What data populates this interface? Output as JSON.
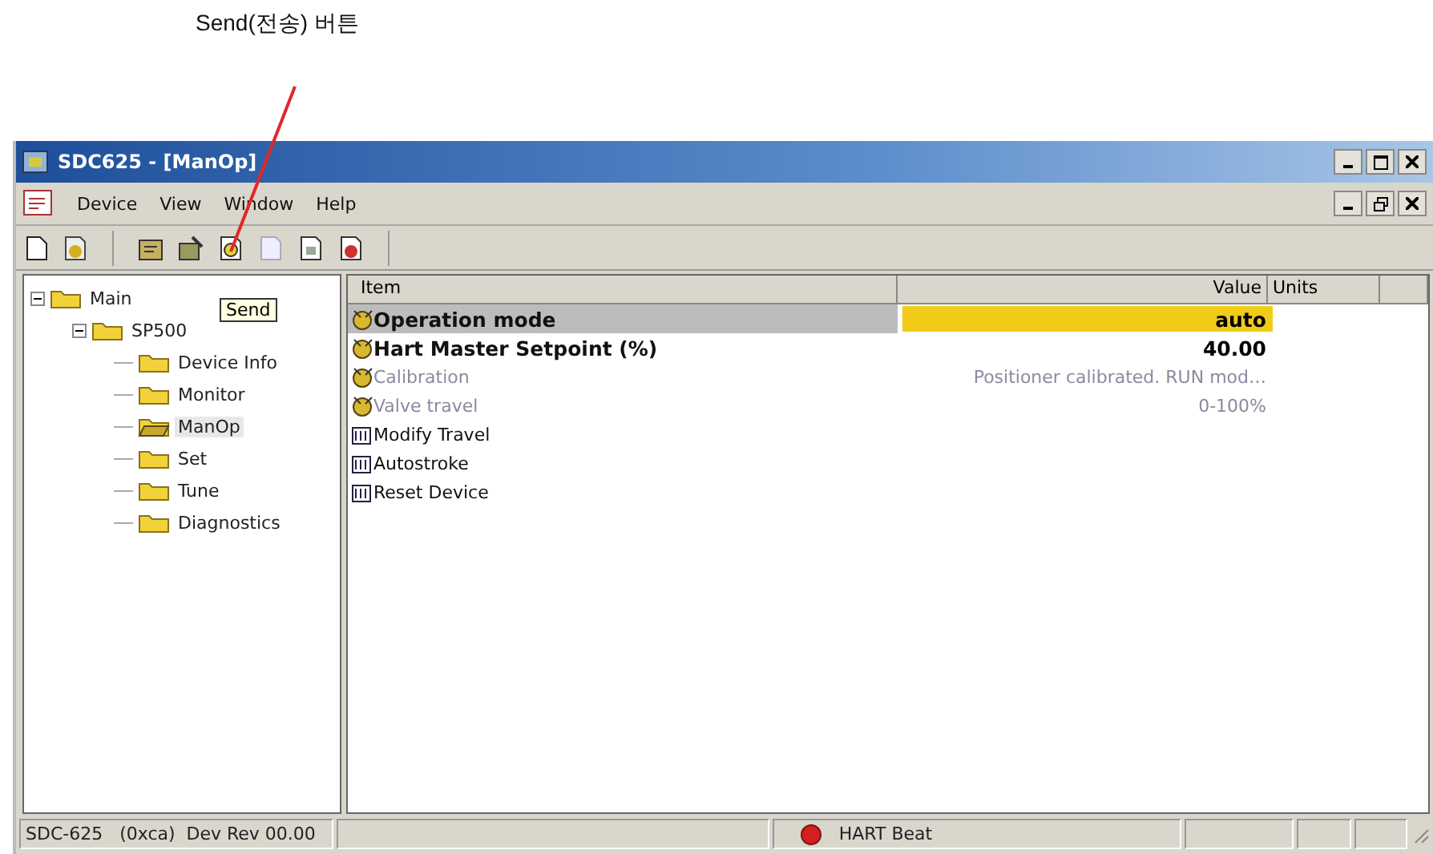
{
  "annotation": {
    "label": "Send(전송) 버튼"
  },
  "window": {
    "title": "SDC625 - [ManOp]"
  },
  "menu": [
    "Device",
    "View",
    "Window",
    "Help"
  ],
  "tooltip": "Send",
  "tree": [
    {
      "label": "Main",
      "expanded": true,
      "selected": false,
      "children": [
        {
          "label": "SP500",
          "expanded": true,
          "selected": false,
          "children": [
            {
              "label": "Device Info",
              "selected": false
            },
            {
              "label": "Monitor",
              "selected": false
            },
            {
              "label": "ManOp",
              "selected": true
            },
            {
              "label": "Set",
              "selected": false
            },
            {
              "label": "Tune",
              "selected": false
            },
            {
              "label": "Diagnostics",
              "selected": false
            }
          ]
        }
      ]
    }
  ],
  "table": {
    "columns": [
      "Item",
      "Value",
      "Units"
    ],
    "rows": [
      {
        "kind": "variable",
        "item": "Operation mode",
        "value": "auto",
        "bold": true,
        "disabled": false,
        "selected": true
      },
      {
        "kind": "variable",
        "item": "Hart Master Setpoint (%)",
        "value": "40.00",
        "bold": true,
        "disabled": false,
        "selected": false
      },
      {
        "kind": "variable",
        "item": "Calibration",
        "value": "Positioner calibrated. RUN mod…",
        "bold": false,
        "disabled": true,
        "selected": false
      },
      {
        "kind": "variable",
        "item": "Valve travel",
        "value": "0-100%",
        "bold": false,
        "disabled": true,
        "selected": false
      },
      {
        "kind": "method",
        "item": "Modify Travel",
        "bold": false,
        "disabled": false,
        "selected": false
      },
      {
        "kind": "method",
        "item": "Autostroke",
        "bold": false,
        "disabled": false,
        "selected": false
      },
      {
        "kind": "method",
        "item": "Reset Device",
        "bold": false,
        "disabled": false,
        "selected": false
      }
    ]
  },
  "status_bar": {
    "device": "SDC-625   (0xca)  Dev Rev 00.00",
    "beat": "HART Beat"
  }
}
